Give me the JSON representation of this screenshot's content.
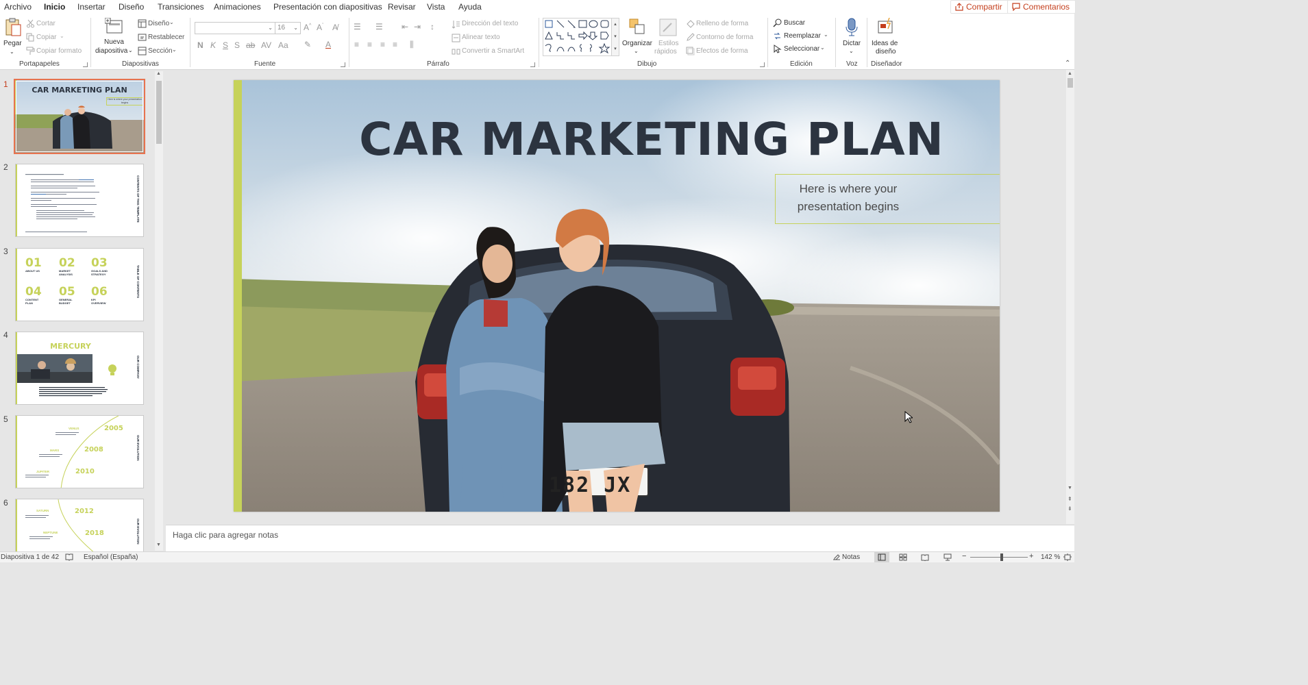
{
  "menu": {
    "tabs": [
      "Archivo",
      "Inicio",
      "Insertar",
      "Diseño",
      "Transiciones",
      "Animaciones",
      "Presentación con diapositivas",
      "Revisar",
      "Vista",
      "Ayuda"
    ],
    "share_label": "Compartir",
    "comments_label": "Comentarios"
  },
  "ribbon": {
    "clipboard": {
      "label": "Portapapeles",
      "paste": "Pegar",
      "cut": "Cortar",
      "copy": "Copiar",
      "format_painter": "Copiar formato"
    },
    "slides": {
      "label": "Diapositivas",
      "new_slide_1": "Nueva",
      "new_slide_2": "diapositiva",
      "layout": "Diseño",
      "reset": "Restablecer",
      "section": "Sección"
    },
    "font": {
      "label": "Fuente",
      "font_name": "",
      "font_size": "16"
    },
    "paragraph": {
      "label": "Párrafo",
      "text_direction": "Dirección del texto",
      "align_text": "Alinear texto",
      "smartart": "Convertir a SmartArt"
    },
    "drawing": {
      "label": "Dibujo",
      "arrange": "Organizar",
      "quick_styles_1": "Estilos",
      "quick_styles_2": "rápidos",
      "shape_fill": "Relleno de forma",
      "shape_outline": "Contorno de forma",
      "shape_effects": "Efectos de forma"
    },
    "editing": {
      "label": "Edición",
      "find": "Buscar",
      "replace": "Reemplazar",
      "select": "Seleccionar"
    },
    "voice": {
      "label": "Voz",
      "dictate": "Dictar"
    },
    "designer": {
      "label": "Diseñador",
      "ideas_1": "Ideas de",
      "ideas_2": "diseño"
    }
  },
  "thumbnails": {
    "numbers": [
      "1",
      "2",
      "3",
      "4",
      "5",
      "6"
    ],
    "t1_title": "CAR MARKETING PLAN",
    "t1_sub": "Here is where your presentation begins",
    "t2_side": "CONTENTS OF THIS TEMPLATE",
    "t3_side": "TABLE OF CONTENTS",
    "t3_items": [
      {
        "num": "01",
        "label": "ABOUT US"
      },
      {
        "num": "02",
        "label": "MARKET ANALYSIS"
      },
      {
        "num": "03",
        "label": "GOALS AND STRATEGY"
      },
      {
        "num": "04",
        "label": "CONTENT PLAN"
      },
      {
        "num": "05",
        "label": "GENERAL BUDGET"
      },
      {
        "num": "06",
        "label": "KPI OVERVIEW"
      }
    ],
    "t4_title": "MERCURY",
    "t4_side": "OUR COMPANY",
    "t5_side": "OUR EVOLUTION",
    "t5_items": [
      {
        "name": "VENUS",
        "year": "2005"
      },
      {
        "name": "MARS",
        "year": "2008"
      },
      {
        "name": "JUPITER",
        "year": "2010"
      }
    ],
    "t6_side": "OUR EVOLUTION",
    "t6_items": [
      {
        "name": "SATURN",
        "year": "2012"
      },
      {
        "name": "NEPTUNE",
        "year": "2018"
      }
    ]
  },
  "slide": {
    "title": "CAR MARKETING PLAN",
    "subtitle": "Here is where your presentation begins",
    "plate": "182 JX"
  },
  "notes": {
    "placeholder": "Haga clic para agregar notas"
  },
  "status": {
    "slide_counter": "Diapositiva 1 de 42",
    "language": "Español (España)",
    "notes_label": "Notas",
    "zoom": "142 %"
  },
  "colors": {
    "accent": "#c43e1c",
    "lime": "#c6d25a",
    "title": "#2c3440"
  }
}
